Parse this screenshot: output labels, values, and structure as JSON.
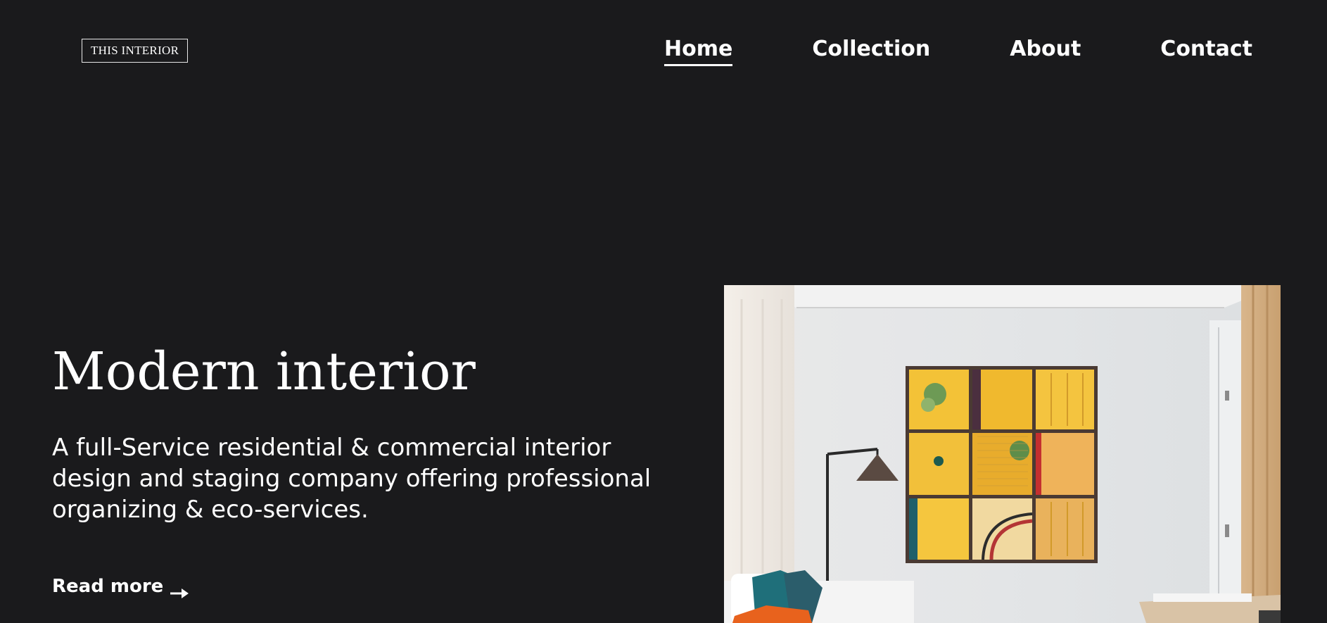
{
  "header": {
    "logo_text": "THIS INTERIOR",
    "nav": [
      {
        "label": "Home",
        "active": true
      },
      {
        "label": "Collection",
        "active": false
      },
      {
        "label": "About",
        "active": false
      },
      {
        "label": "Contact",
        "active": false
      }
    ]
  },
  "hero": {
    "title": "Modern interior",
    "description": "A full-Service residential & commercial interior design and staging company offering professional organizing & eco-services.",
    "read_more_label": "Read more",
    "read_more_icon": "arrow-right-icon",
    "image_icon": "interior-photo"
  },
  "colors": {
    "background": "#1a1a1c",
    "text": "#ffffff",
    "accent_yellow": "#f3c237",
    "accent_teal": "#1f6f7a",
    "accent_orange": "#e8621d"
  }
}
